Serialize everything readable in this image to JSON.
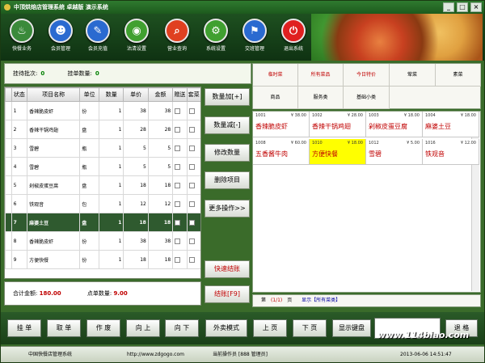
{
  "window": {
    "title": "中顶烘焙店管理系统  卓越版  演示系统",
    "minimize": "_",
    "maximize": "□",
    "close": "×"
  },
  "toolbar": [
    {
      "label": "快餐业务",
      "icon": "dish-icon",
      "color": "#3a8a3a",
      "glyph": "♨"
    },
    {
      "label": "会员管理",
      "icon": "member-icon",
      "color": "#2a6ad0",
      "glyph": "☻"
    },
    {
      "label": "会员充值",
      "icon": "recharge-icon",
      "color": "#2a6ad0",
      "glyph": "✎"
    },
    {
      "label": "沽清设置",
      "icon": "sold-out-icon",
      "color": "#40a030",
      "glyph": "◉"
    },
    {
      "label": "营业查询",
      "icon": "search-icon",
      "color": "#e04020",
      "glyph": "⌕"
    },
    {
      "label": "系统设置",
      "icon": "gear-icon",
      "color": "#40a030",
      "glyph": "⚙"
    },
    {
      "label": "交班管理",
      "icon": "shift-icon",
      "color": "#2a6ad0",
      "glyph": "⚑"
    },
    {
      "label": "退出系统",
      "icon": "power-icon",
      "color": "#e02020",
      "glyph": "⏻"
    }
  ],
  "info": {
    "batch_label": "挂待批次:",
    "batch_value": "0",
    "count_label": "挂单数量:",
    "count_value": "0"
  },
  "order_table": {
    "headers": [
      "状态",
      "项目名称",
      "单位",
      "数量",
      "单价",
      "金额",
      "赠送",
      "套菜"
    ],
    "rows": [
      {
        "no": "1",
        "name": "香辣脆皮虾",
        "unit": "份",
        "qty": "1",
        "price": "38",
        "amount": "38"
      },
      {
        "no": "2",
        "name": "香辣干锅鸡翅",
        "unit": "盘",
        "qty": "1",
        "price": "28",
        "amount": "28"
      },
      {
        "no": "3",
        "name": "雪碧",
        "unit": "瓶",
        "qty": "1",
        "price": "5",
        "amount": "5"
      },
      {
        "no": "4",
        "name": "雪碧",
        "unit": "瓶",
        "qty": "1",
        "price": "5",
        "amount": "5"
      },
      {
        "no": "5",
        "name": "剁椒皮蛋豆腐",
        "unit": "盘",
        "qty": "1",
        "price": "18",
        "amount": "18"
      },
      {
        "no": "6",
        "name": "铁观音",
        "unit": "包",
        "qty": "1",
        "price": "12",
        "amount": "12"
      },
      {
        "no": "7",
        "name": "麻婆土豆",
        "unit": "盘",
        "qty": "1",
        "price": "18",
        "amount": "18"
      },
      {
        "no": "8",
        "name": "香辣脆皮虾",
        "unit": "份",
        "qty": "1",
        "price": "38",
        "amount": "38"
      },
      {
        "no": "9",
        "name": "方便快餐",
        "unit": "份",
        "qty": "1",
        "price": "18",
        "amount": "18"
      }
    ],
    "selected_row": 6
  },
  "totals": {
    "sum_label": "合计金额:",
    "sum_value": "180.00",
    "qty_label": "点单数量:",
    "qty_value": "9.00"
  },
  "mid_buttons": [
    "数量加[+]",
    "数量减[-]",
    "修改数量",
    "删除项目",
    "更多操作>>",
    "快速结账",
    "结账[F9]"
  ],
  "categories": [
    "临时菜",
    "所有菜品",
    "今日特价",
    "荤菜",
    "素菜",
    "商品",
    "服务类",
    "基础小类"
  ],
  "dishes": [
    {
      "code": "1001",
      "price": "¥ 38.00",
      "name": "香辣脆皮虾"
    },
    {
      "code": "1002",
      "price": "¥ 28.00",
      "name": "香辣干锅鸡翅"
    },
    {
      "code": "1003",
      "price": "¥ 18.00",
      "name": "剁椒皮蛋豆腐"
    },
    {
      "code": "1004",
      "price": "¥ 18.00",
      "name": "麻婆土豆"
    },
    {
      "code": "1008",
      "price": "¥ 60.00",
      "name": "五香酱牛肉"
    },
    {
      "code": "1010",
      "price": "¥ 18.00",
      "name": "方便快餐"
    },
    {
      "code": "1012",
      "price": "¥ 5.00",
      "name": "雪碧"
    },
    {
      "code": "1016",
      "price": "¥ 12.00",
      "name": "铁观音"
    }
  ],
  "pager": {
    "first": "第",
    "current": "(1/1)",
    "page": "页",
    "showing": "显示【所有菜类】"
  },
  "bottom_buttons": [
    "挂 单",
    "取 单",
    "作 废",
    "向 上",
    "向 下",
    "外卖模式",
    "上 页",
    "下 页",
    "显示键盘",
    "退 格"
  ],
  "status": {
    "company": "中国快餐店管理系统",
    "url": "http://www.zdgogo.com",
    "operator": "当前操作员 [888 管理员]",
    "datetime": "2013-06-06 14:51:47"
  },
  "watermark": "www.114biao.com"
}
